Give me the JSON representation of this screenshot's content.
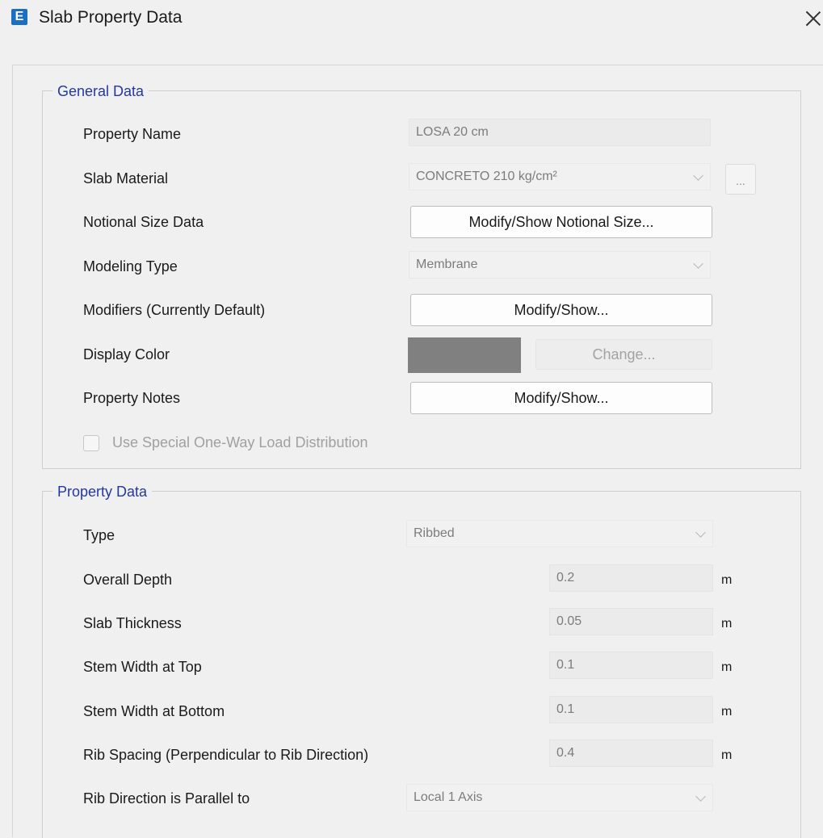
{
  "window": {
    "title": "Slab Property Data",
    "app_icon_letter": "E",
    "close_icon": "close-icon"
  },
  "general": {
    "title": "General Data",
    "property_name_label": "Property Name",
    "property_name_value": "LOSA 20 cm",
    "slab_material_label": "Slab Material",
    "slab_material_value": "CONCRETO 210 kg/cm²",
    "slab_material_more": "...",
    "notional_label": "Notional Size Data",
    "notional_button": "Modify/Show Notional Size...",
    "modeling_label": "Modeling Type",
    "modeling_value": "Membrane",
    "modifiers_label": "Modifiers (Currently Default)",
    "modifiers_button": "Modify/Show...",
    "display_color_label": "Display Color",
    "display_color_value": "#808080",
    "change_button": "Change...",
    "notes_label": "Property Notes",
    "notes_button": "Modify/Show...",
    "one_way_checkbox_label": "Use Special One-Way Load Distribution",
    "one_way_checked": false
  },
  "property": {
    "title": "Property Data",
    "type_label": "Type",
    "type_value": "Ribbed",
    "overall_depth_label": "Overall Depth",
    "overall_depth_value": "0.2",
    "slab_thickness_label": "Slab Thickness",
    "slab_thickness_value": "0.05",
    "stem_top_label": "Stem Width at Top",
    "stem_top_value": "0.1",
    "stem_bottom_label": "Stem Width at Bottom",
    "stem_bottom_value": "0.1",
    "rib_spacing_label": "Rib Spacing (Perpendicular to Rib Direction)",
    "rib_spacing_value": "0.4",
    "unit": "m",
    "rib_direction_label": "Rib Direction is Parallel to",
    "rib_direction_value": "Local 1 Axis"
  }
}
